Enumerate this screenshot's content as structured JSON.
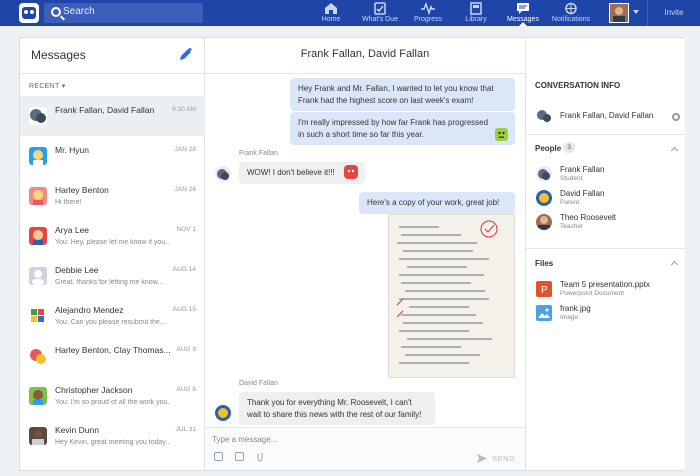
{
  "topbar": {
    "search_placeholder": "Search",
    "nav": [
      {
        "label": "Home",
        "icon": "home-icon"
      },
      {
        "label": "What's Due",
        "icon": "clipboard-icon"
      },
      {
        "label": "Progress",
        "icon": "pulse-icon"
      },
      {
        "label": "Library",
        "icon": "library-icon"
      },
      {
        "label": "Messages",
        "icon": "chat-icon"
      },
      {
        "label": "Notifications",
        "icon": "globe-icon"
      }
    ],
    "active_nav": "Messages",
    "invite_label": "Invite"
  },
  "sidebar": {
    "title": "Messages",
    "filter_label": "RECENT",
    "conversations": [
      {
        "name": "Frank Fallan, David Fallan",
        "preview": "",
        "time": "9:30 AM",
        "selected": true
      },
      {
        "name": "Mr. Hyun",
        "preview": "",
        "time": "JAN 28"
      },
      {
        "name": "Harley Benton",
        "preview": "Hi there!",
        "time": "JAN 26"
      },
      {
        "name": "Arya Lee",
        "preview": "You: Hey, please let me know if you...",
        "time": "NOV 1"
      },
      {
        "name": "Debbie Lee",
        "preview": "Great, thanks for letting me know...",
        "time": "AUG 14"
      },
      {
        "name": "Alejandro Mendez",
        "preview": "You: Can you please resubmit the...",
        "time": "AUG 15"
      },
      {
        "name": "Harley Benton, Clay Thomas...",
        "preview": "",
        "time": "AUG 9"
      },
      {
        "name": "Christopher Jackson",
        "preview": "You: I'm so proud of all the work you...",
        "time": "AUG 8"
      },
      {
        "name": "Kevin Dunn",
        "preview": "Hey Kevin, great meeting you today...",
        "time": "JUL 31"
      }
    ]
  },
  "conversation": {
    "title": "Frank Fallan, David Fallan",
    "messages": [
      {
        "from": "me",
        "text": "Hey Frank and Mr. Fallan, I wanted to let you know that Frank had the highest score on last week's exam!"
      },
      {
        "from": "me",
        "text": "I'm really impressed by how far Frank has progressed in such a short time so far this year."
      },
      {
        "from": "Frank Fallan",
        "text": "WOW! I don't believe it!!!"
      },
      {
        "from": "me",
        "text": "Here's a copy of your work, great job!"
      },
      {
        "from": "David Fallan",
        "text": "Thank you for everything Mr. Roosevelt, I can't wait to share this news with the rest of our family!"
      }
    ],
    "input_placeholder": "Type a message...",
    "send_label": "SEND"
  },
  "info": {
    "title": "CONVERSATION INFO",
    "conversation_name": "Frank Fallan, David Fallan",
    "people_label": "People",
    "people_count": "3",
    "people": [
      {
        "name": "Frank Fallan",
        "role": "Student"
      },
      {
        "name": "David Fallan",
        "role": "Parent"
      },
      {
        "name": "Theo Roosevelt",
        "role": "Teacher"
      }
    ],
    "files_label": "Files",
    "files": [
      {
        "name": "Team 5 presentation.pptx",
        "type": "Powerpoint Document",
        "color": "#e2522b"
      },
      {
        "name": "frank.jpg",
        "type": "Image",
        "color": "#4aa3df"
      }
    ]
  },
  "colors": {
    "topbar": "#1f45a8",
    "outgoing_bubble": "#dbe7f8",
    "incoming_bubble": "#eeeff1"
  }
}
